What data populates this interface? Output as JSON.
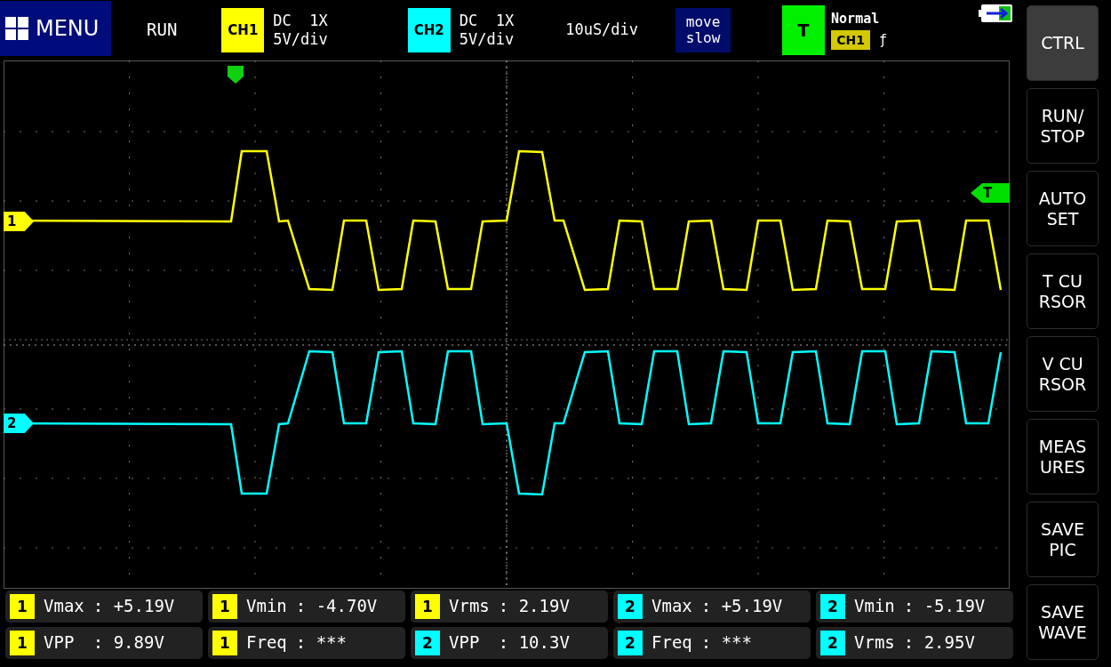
{
  "header": {
    "menu": {
      "label": "MENU"
    },
    "run_state": "RUN",
    "channels": [
      {
        "label": "CH1",
        "color": "#ffff00",
        "coupling": "DC  1X",
        "scale": "5V/div"
      },
      {
        "label": "CH2",
        "color": "#00ffff",
        "coupling": "DC  1X",
        "scale": "5V/div"
      }
    ],
    "timebase": "10uS/div",
    "move_button": "move\nslow",
    "trigger": {
      "label": "T",
      "mode": "Normal",
      "source": "CH1",
      "edge": "ƒ"
    }
  },
  "plot": {
    "markers": [
      {
        "kind": "ch1",
        "label": "1",
        "color": "#ffff00"
      },
      {
        "kind": "ch2",
        "label": "2",
        "color": "#00ffff"
      },
      {
        "kind": "trigger",
        "label": "T",
        "color": "#00e000"
      }
    ]
  },
  "measurements": [
    [
      {
        "channel": "1",
        "color": "#ffff00",
        "name": "Vmax",
        "value": ": +5.19V"
      },
      {
        "channel": "1",
        "color": "#ffff00",
        "name": "Vmin",
        "value": ": -4.70V"
      },
      {
        "channel": "1",
        "color": "#ffff00",
        "name": "Vrms",
        "value": ": 2.19V"
      },
      {
        "channel": "2",
        "color": "#00ffff",
        "name": "Vmax",
        "value": ": +5.19V"
      },
      {
        "channel": "2",
        "color": "#00ffff",
        "name": "Vmin",
        "value": ": -5.19V"
      }
    ],
    [
      {
        "channel": "1",
        "color": "#ffff00",
        "name": "VPP ",
        "value": ": 9.89V"
      },
      {
        "channel": "1",
        "color": "#ffff00",
        "name": "Freq",
        "value": ": ***"
      },
      {
        "channel": "2",
        "color": "#00ffff",
        "name": "VPP ",
        "value": ": 10.3V"
      },
      {
        "channel": "2",
        "color": "#00ffff",
        "name": "Freq",
        "value": ": ***"
      },
      {
        "channel": "2",
        "color": "#00ffff",
        "name": "Vrms",
        "value": ": 2.95V"
      }
    ]
  ],
  "sidebar": [
    {
      "label": "CTRL",
      "selected": true
    },
    {
      "label": "RUN/\nSTOP",
      "selected": false
    },
    {
      "label": "AUTO\nSET",
      "selected": false
    },
    {
      "label": "T CU\nRSOR",
      "selected": false
    },
    {
      "label": "V CU\nRSOR",
      "selected": false
    },
    {
      "label": "MEAS\nURES",
      "selected": false
    },
    {
      "label": "SAVE\nPIC",
      "selected": false
    },
    {
      "label": "SAVE\nWAVE",
      "selected": false
    }
  ]
}
